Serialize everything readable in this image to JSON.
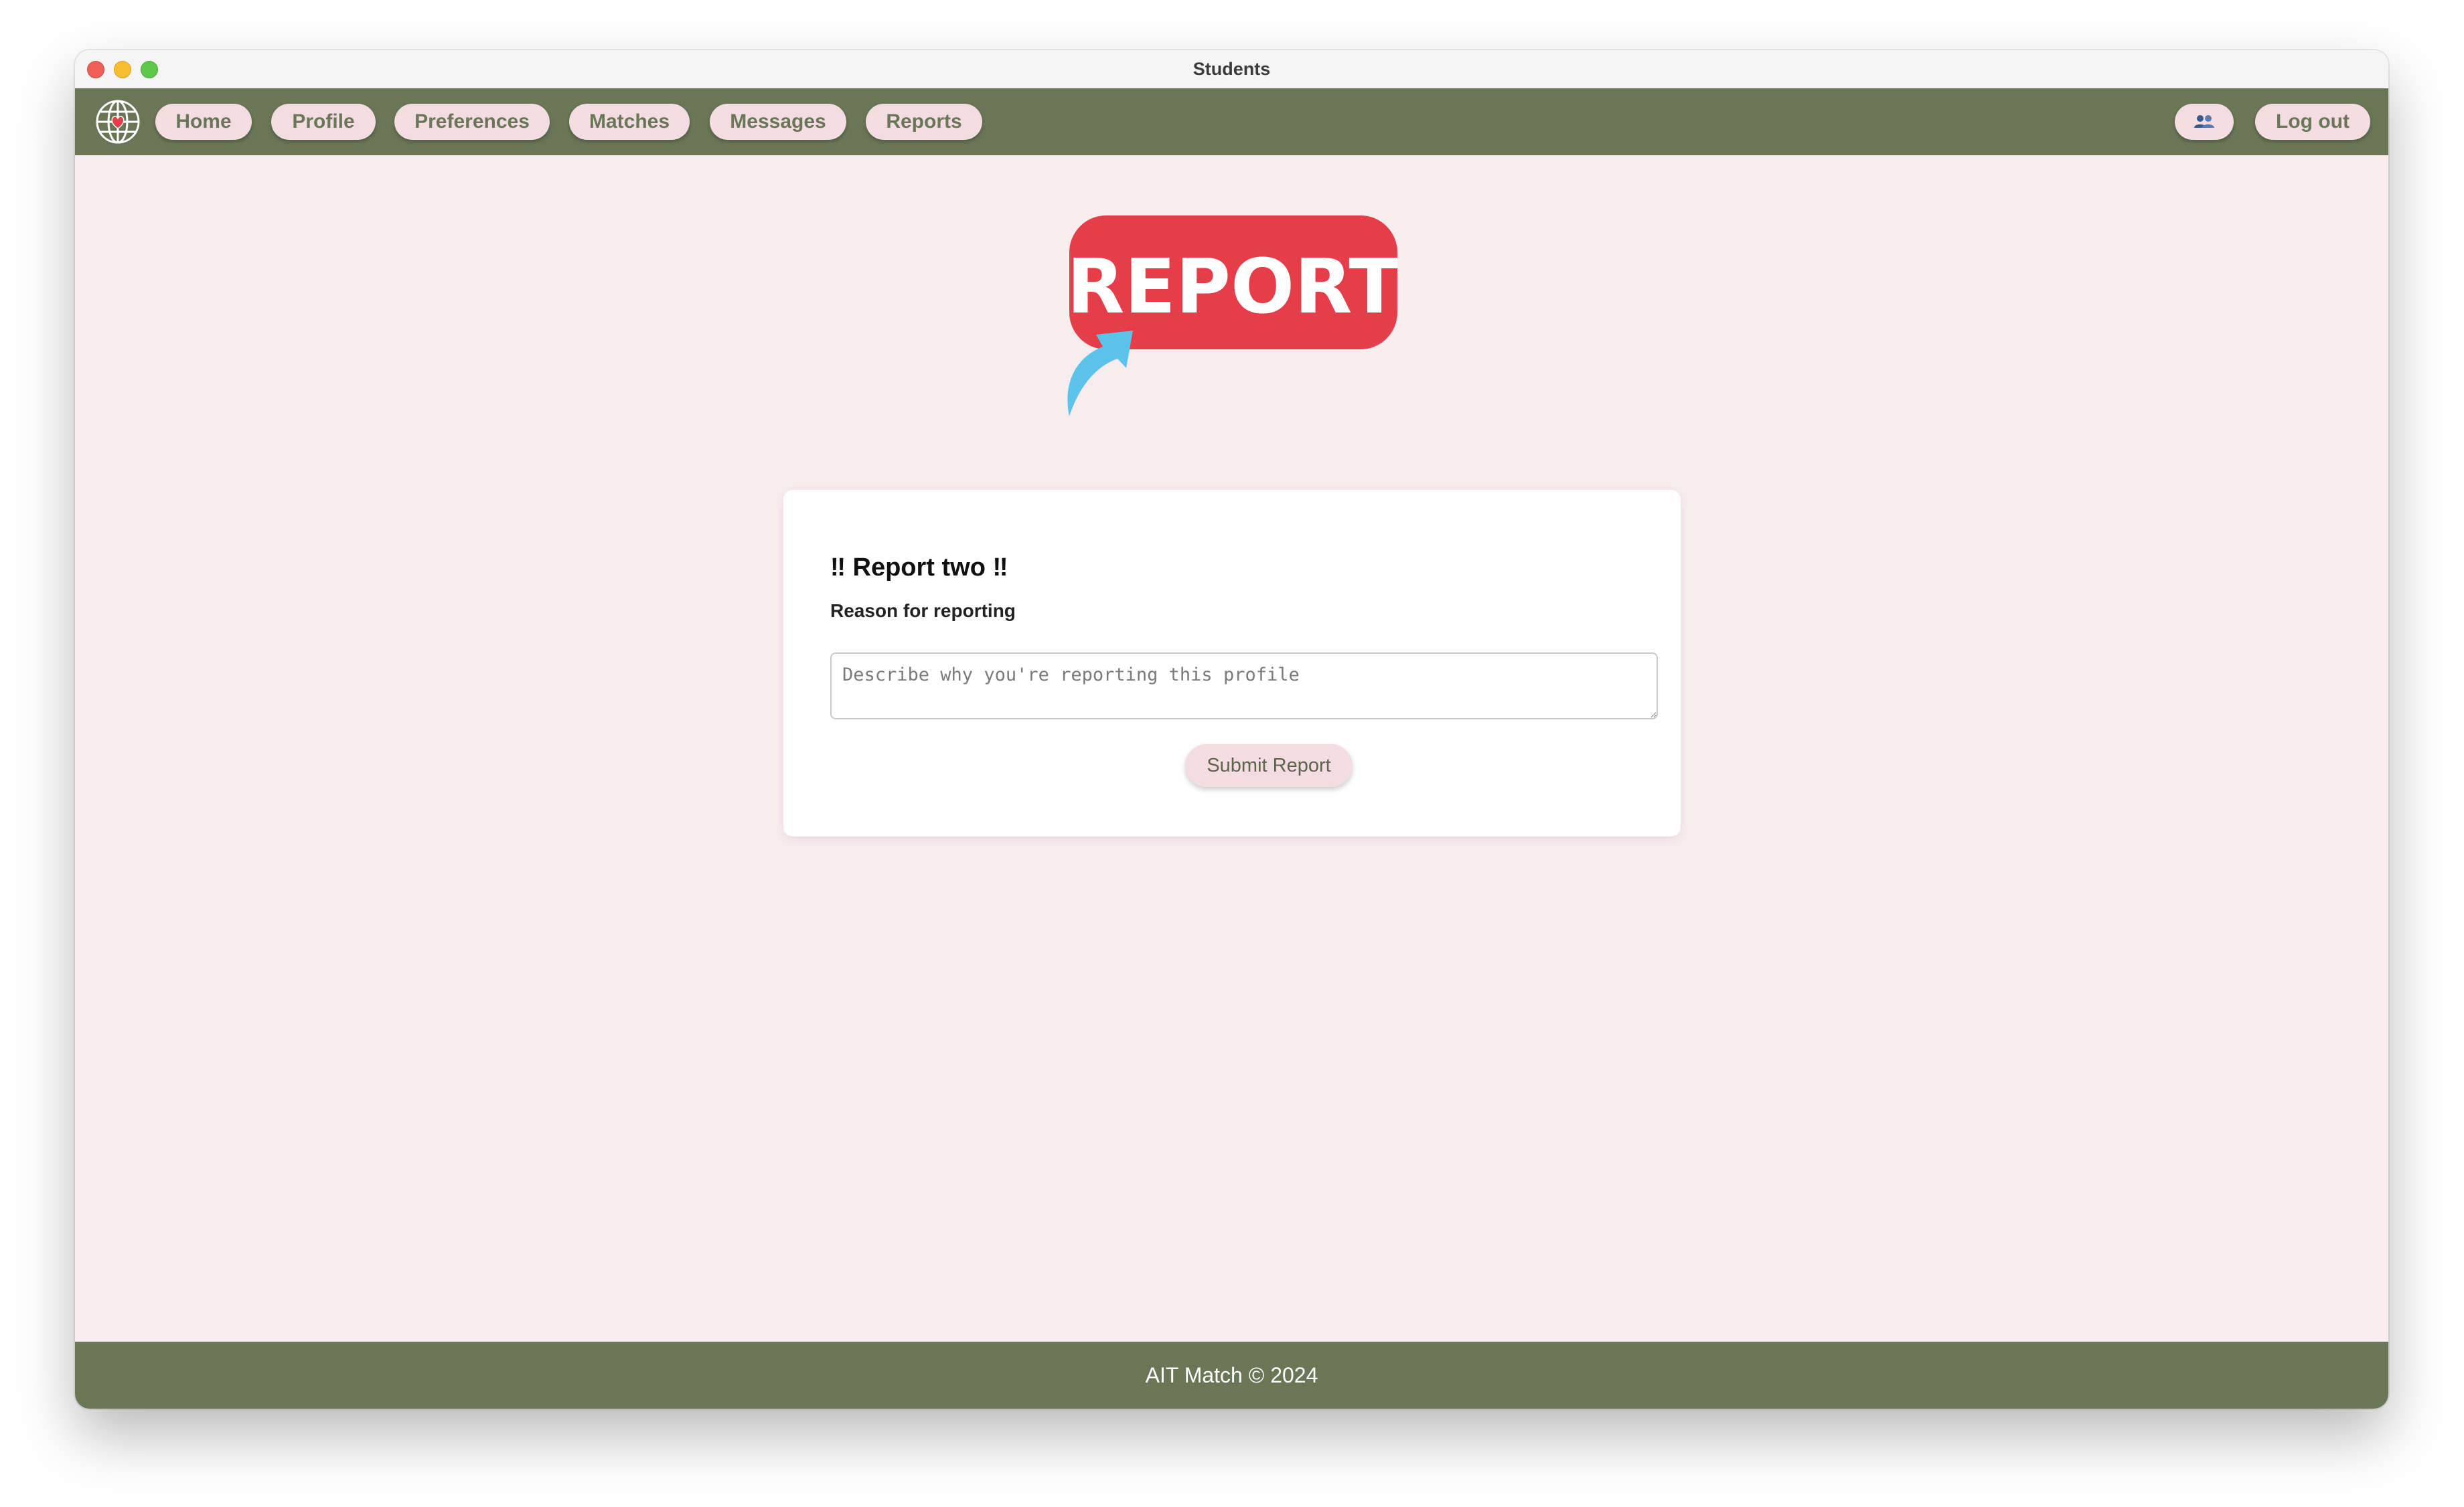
{
  "window": {
    "title": "Students"
  },
  "nav": {
    "items": [
      {
        "label": "Home"
      },
      {
        "label": "Profile"
      },
      {
        "label": "Preferences"
      },
      {
        "label": "Matches"
      },
      {
        "label": "Messages"
      },
      {
        "label": "Reports"
      }
    ],
    "users_icon": "users-icon",
    "logout_label": "Log out"
  },
  "banner": {
    "text": "REPORT",
    "color": "#e53d49",
    "arrow_color": "#5bc3ea"
  },
  "report_form": {
    "title": "‼ Report two ‼",
    "reason_label": "Reason for reporting",
    "reason_placeholder": "Describe why you're reporting this profile",
    "reason_value": "",
    "submit_label": "Submit Report"
  },
  "footer": {
    "text": "AIT Match © 2024"
  },
  "colors": {
    "nav_bg": "#6a7757",
    "page_bg": "#f9ecef",
    "pill_bg": "#f3dde2"
  }
}
